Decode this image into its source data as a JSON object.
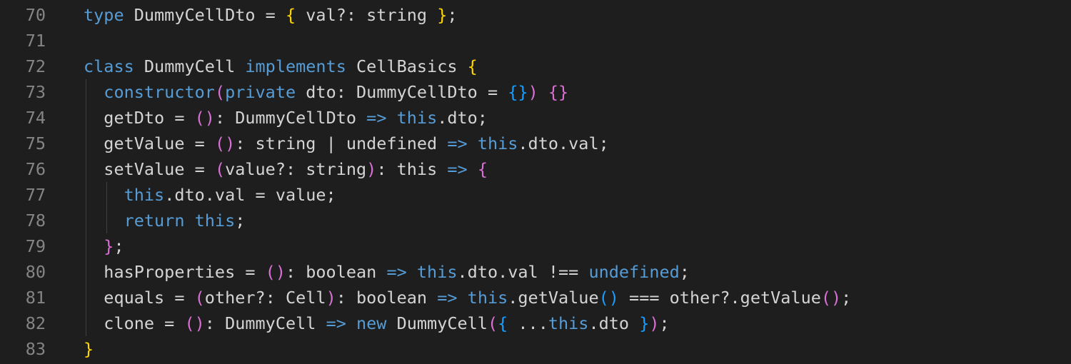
{
  "editor": {
    "lines": [
      {
        "number": "70",
        "tokens": [
          {
            "t": "type",
            "c": "kw"
          },
          {
            "t": " DummyCellDto = ",
            "c": "tx"
          },
          {
            "t": "{",
            "c": "br1"
          },
          {
            "t": " val?: string ",
            "c": "tx"
          },
          {
            "t": "}",
            "c": "br1"
          },
          {
            "t": ";",
            "c": "tx"
          }
        ]
      },
      {
        "number": "71",
        "tokens": []
      },
      {
        "number": "72",
        "tokens": [
          {
            "t": "class",
            "c": "kw"
          },
          {
            "t": " DummyCell ",
            "c": "tx"
          },
          {
            "t": "implements",
            "c": "kw"
          },
          {
            "t": " CellBasics ",
            "c": "tx"
          },
          {
            "t": "{",
            "c": "br1"
          }
        ]
      },
      {
        "number": "73",
        "tokens": [
          {
            "t": "  ",
            "c": "tx"
          },
          {
            "t": "constructor",
            "c": "kw"
          },
          {
            "t": "(",
            "c": "br2"
          },
          {
            "t": "private",
            "c": "kw"
          },
          {
            "t": " dto: DummyCellDto = ",
            "c": "tx"
          },
          {
            "t": "{}",
            "c": "br3"
          },
          {
            "t": ")",
            "c": "br2"
          },
          {
            "t": " ",
            "c": "tx"
          },
          {
            "t": "{}",
            "c": "br2"
          }
        ]
      },
      {
        "number": "74",
        "tokens": [
          {
            "t": "  getDto = ",
            "c": "tx"
          },
          {
            "t": "()",
            "c": "br2"
          },
          {
            "t": ": DummyCellDto ",
            "c": "tx"
          },
          {
            "t": "=>",
            "c": "kw"
          },
          {
            "t": " ",
            "c": "tx"
          },
          {
            "t": "this",
            "c": "kw"
          },
          {
            "t": ".dto;",
            "c": "tx"
          }
        ]
      },
      {
        "number": "75",
        "tokens": [
          {
            "t": "  getValue = ",
            "c": "tx"
          },
          {
            "t": "()",
            "c": "br2"
          },
          {
            "t": ": string | undefined ",
            "c": "tx"
          },
          {
            "t": "=>",
            "c": "kw"
          },
          {
            "t": " ",
            "c": "tx"
          },
          {
            "t": "this",
            "c": "kw"
          },
          {
            "t": ".dto.val;",
            "c": "tx"
          }
        ]
      },
      {
        "number": "76",
        "tokens": [
          {
            "t": "  setValue = ",
            "c": "tx"
          },
          {
            "t": "(",
            "c": "br2"
          },
          {
            "t": "value?: string",
            "c": "tx"
          },
          {
            "t": ")",
            "c": "br2"
          },
          {
            "t": ": this ",
            "c": "tx"
          },
          {
            "t": "=>",
            "c": "kw"
          },
          {
            "t": " ",
            "c": "tx"
          },
          {
            "t": "{",
            "c": "br2"
          }
        ]
      },
      {
        "number": "77",
        "tokens": [
          {
            "t": "    ",
            "c": "tx"
          },
          {
            "t": "this",
            "c": "kw"
          },
          {
            "t": ".dto.val = value;",
            "c": "tx"
          }
        ]
      },
      {
        "number": "78",
        "tokens": [
          {
            "t": "    ",
            "c": "tx"
          },
          {
            "t": "return",
            "c": "kw"
          },
          {
            "t": " ",
            "c": "tx"
          },
          {
            "t": "this",
            "c": "kw"
          },
          {
            "t": ";",
            "c": "tx"
          }
        ]
      },
      {
        "number": "79",
        "tokens": [
          {
            "t": "  ",
            "c": "tx"
          },
          {
            "t": "}",
            "c": "br2"
          },
          {
            "t": ";",
            "c": "tx"
          }
        ]
      },
      {
        "number": "80",
        "tokens": [
          {
            "t": "  hasProperties = ",
            "c": "tx"
          },
          {
            "t": "()",
            "c": "br2"
          },
          {
            "t": ": boolean ",
            "c": "tx"
          },
          {
            "t": "=>",
            "c": "kw"
          },
          {
            "t": " ",
            "c": "tx"
          },
          {
            "t": "this",
            "c": "kw"
          },
          {
            "t": ".dto.val !== ",
            "c": "tx"
          },
          {
            "t": "undefined",
            "c": "kw"
          },
          {
            "t": ";",
            "c": "tx"
          }
        ]
      },
      {
        "number": "81",
        "tokens": [
          {
            "t": "  equals = ",
            "c": "tx"
          },
          {
            "t": "(",
            "c": "br2"
          },
          {
            "t": "other?: Cell",
            "c": "tx"
          },
          {
            "t": ")",
            "c": "br2"
          },
          {
            "t": ": boolean ",
            "c": "tx"
          },
          {
            "t": "=>",
            "c": "kw"
          },
          {
            "t": " ",
            "c": "tx"
          },
          {
            "t": "this",
            "c": "kw"
          },
          {
            "t": ".getValue",
            "c": "tx"
          },
          {
            "t": "()",
            "c": "br3"
          },
          {
            "t": " === other?.getValue",
            "c": "tx"
          },
          {
            "t": "()",
            "c": "br2"
          },
          {
            "t": ";",
            "c": "tx"
          }
        ]
      },
      {
        "number": "82",
        "tokens": [
          {
            "t": "  clone = ",
            "c": "tx"
          },
          {
            "t": "()",
            "c": "br2"
          },
          {
            "t": ": DummyCell ",
            "c": "tx"
          },
          {
            "t": "=>",
            "c": "kw"
          },
          {
            "t": " ",
            "c": "tx"
          },
          {
            "t": "new",
            "c": "kw"
          },
          {
            "t": " DummyCell",
            "c": "tx"
          },
          {
            "t": "(",
            "c": "br2"
          },
          {
            "t": "{",
            "c": "br3"
          },
          {
            "t": " ...",
            "c": "tx"
          },
          {
            "t": "this",
            "c": "kw"
          },
          {
            "t": ".dto ",
            "c": "tx"
          },
          {
            "t": "}",
            "c": "br3"
          },
          {
            "t": ")",
            "c": "br2"
          },
          {
            "t": ";",
            "c": "tx"
          }
        ]
      },
      {
        "number": "83",
        "tokens": [
          {
            "t": "}",
            "c": "br1"
          }
        ]
      }
    ]
  },
  "colors": {
    "background": "#1e1e1e",
    "line_number": "#858585",
    "keyword": "#569cd6",
    "bracket_level1": "#ffd700",
    "bracket_level2": "#da70d6",
    "bracket_level3": "#179fff",
    "text": "#d4d4d4"
  }
}
